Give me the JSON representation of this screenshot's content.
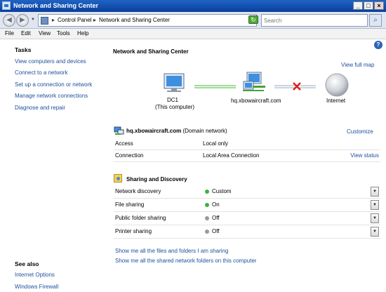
{
  "window": {
    "title": "Network and Sharing Center"
  },
  "nav": {
    "breadcrumb": [
      "Control Panel",
      "Network and Sharing Center"
    ],
    "search_placeholder": "Search"
  },
  "menu": [
    "File",
    "Edit",
    "View",
    "Tools",
    "Help"
  ],
  "left": {
    "tasks_heading": "Tasks",
    "tasks": [
      "View computers and devices",
      "Connect to a network",
      "Set up a connection or network",
      "Manage network connections",
      "Diagnose and repair"
    ],
    "see_also_heading": "See also",
    "see_also": [
      "Internet Options",
      "Windows Firewall"
    ]
  },
  "main": {
    "title": "Network and Sharing Center",
    "view_full_map": "View full map",
    "map": {
      "computer_name": "DC1",
      "computer_sub": "(This computer)",
      "network": "hq.xbowaircraft.com",
      "internet": "Internet",
      "internet_status": "disconnected"
    },
    "network_section": {
      "name": "hq.xbowaircraft.com",
      "type": "(Domain network)",
      "customize": "Customize",
      "rows": [
        {
          "label": "Access",
          "value": "Local only",
          "link": ""
        },
        {
          "label": "Connection",
          "value": "Local Area Connection",
          "link": "View status"
        }
      ]
    },
    "sharing": {
      "title": "Sharing and Discovery",
      "rows": [
        {
          "label": "Network discovery",
          "value": "Custom",
          "status_color": "#3fb23f"
        },
        {
          "label": "File sharing",
          "value": "On",
          "status_color": "#3fb23f"
        },
        {
          "label": "Public folder sharing",
          "value": "Off",
          "status_color": "#9a9a9a"
        },
        {
          "label": "Printer sharing",
          "value": "Off",
          "status_color": "#9a9a9a"
        }
      ]
    },
    "bottom_links": [
      "Show me all the files and folders I am sharing",
      "Show me all the shared network folders on this computer"
    ]
  },
  "colors": {
    "link": "#1d4f9c",
    "titlebar": "#1f63c4",
    "on": "#3fb23f",
    "off": "#9a9a9a",
    "disconnect": "#e0201b"
  }
}
